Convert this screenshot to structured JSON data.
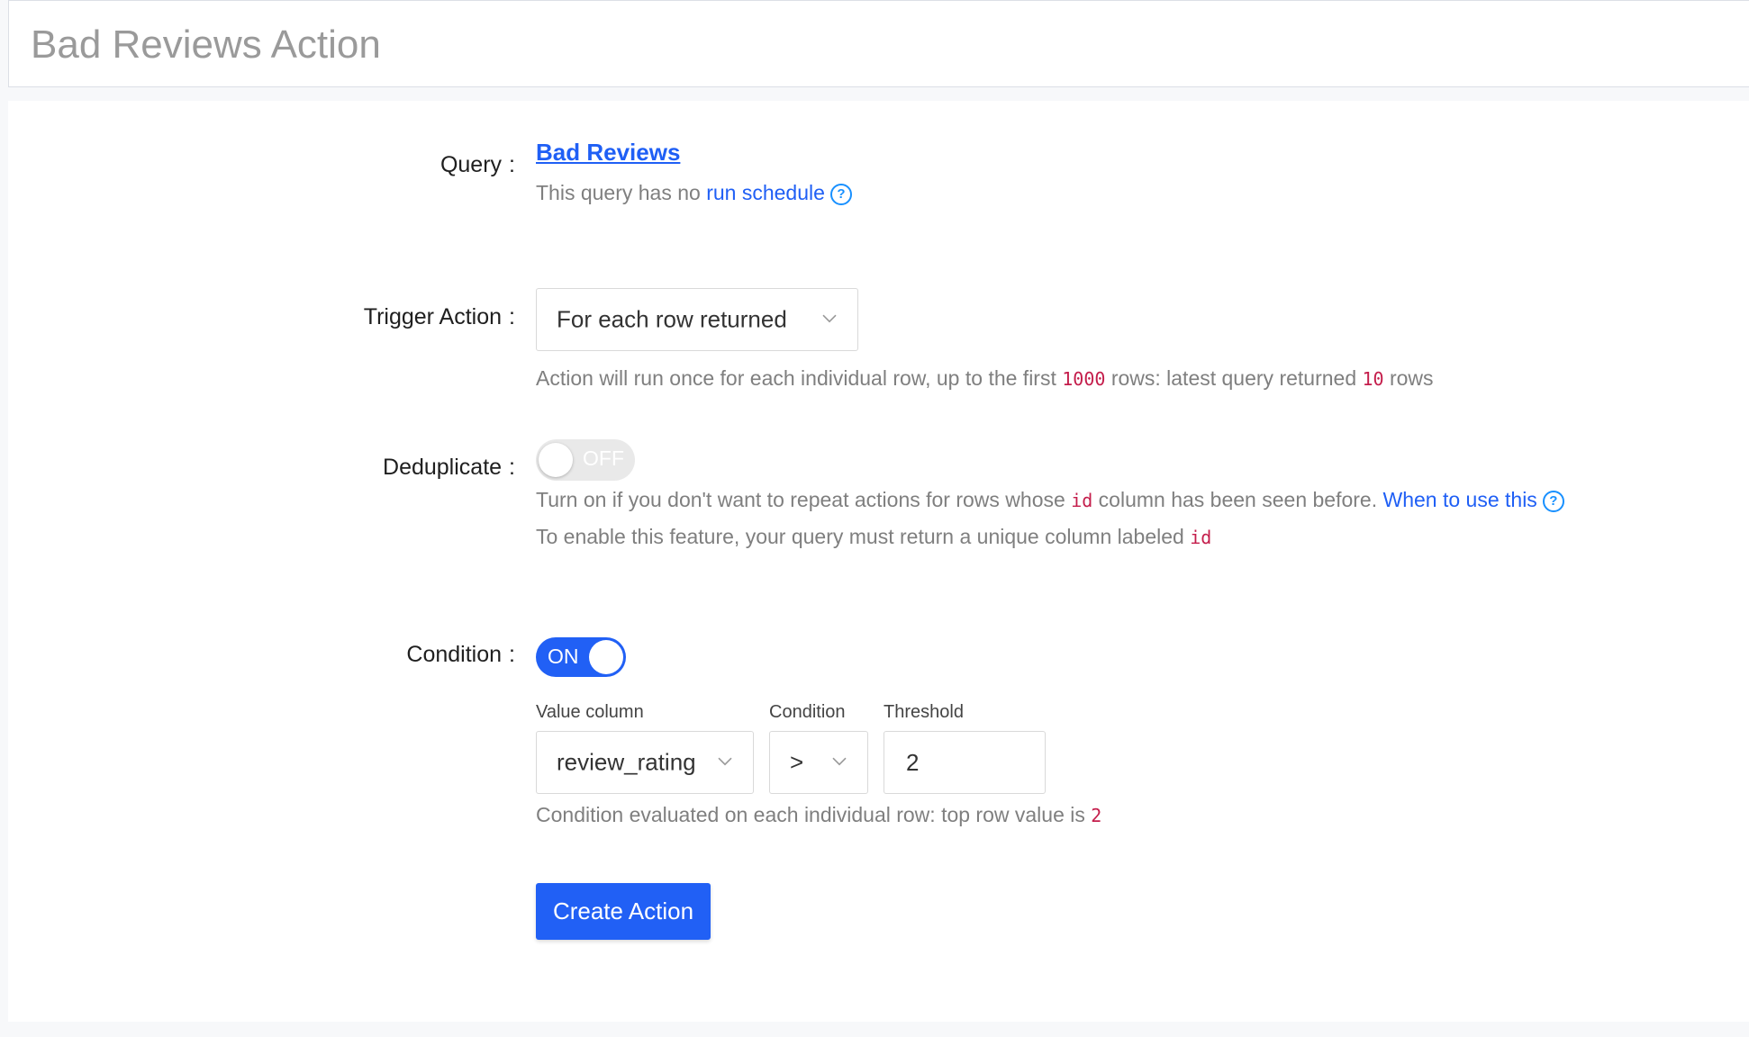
{
  "header": {
    "title": "Bad Reviews Action"
  },
  "query": {
    "label": "Query",
    "colon": ":",
    "name": "Bad Reviews",
    "schedule_text": "This query has no",
    "schedule_link": "run schedule",
    "help_glyph": "?"
  },
  "trigger": {
    "label": "Trigger Action",
    "colon": ":",
    "selected": "For each row returned",
    "desc_part1": "Action will run once for each individual row, up to the first",
    "max_rows": "1000",
    "desc_part2": "rows: latest query returned",
    "latest_rows": "10",
    "desc_part3": "rows"
  },
  "deduplicate": {
    "label": "Deduplicate",
    "colon": ":",
    "toggle_text": "OFF",
    "desc1_part1": "Turn on if you don't want to repeat actions for rows whose",
    "id_code": "id",
    "desc1_part2": "column has been seen before.",
    "help_link": "When to use this",
    "help_glyph": "?",
    "desc2": "To enable this feature, your query must return a unique column labeled",
    "id_code2": "id"
  },
  "condition": {
    "label": "Condition",
    "colon": ":",
    "toggle_text": "ON",
    "value_column_label": "Value column",
    "value_column": "review_rating",
    "operator_label": "Condition",
    "operator": ">",
    "threshold_label": "Threshold",
    "threshold": "2",
    "desc": "Condition evaluated on each individual row: top row value is",
    "top_value": "2"
  },
  "actions": {
    "create_label": "Create Action"
  },
  "colors": {
    "primary": "#2160f5",
    "code": "#c41d4b",
    "muted": "#7f7f7f"
  }
}
